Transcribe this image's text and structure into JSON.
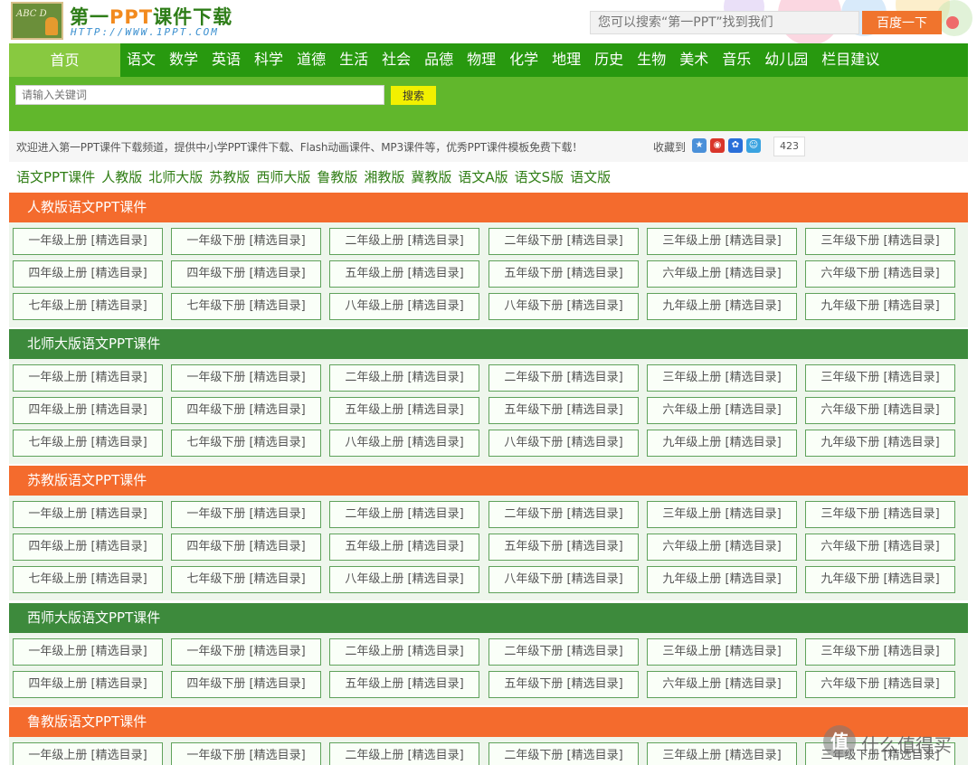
{
  "site": {
    "title_part1": "第一",
    "title_ppt": "PPT",
    "title_part2": "课件下载",
    "url": "HTTP://WWW.1PPT.COM",
    "logo_chalk": "ABC D"
  },
  "top_search": {
    "placeholder": "您可以搜索“第一PPT”找到我们",
    "button": "百度一下"
  },
  "nav": {
    "home": "首页",
    "items": [
      "语文",
      "数学",
      "英语",
      "科学",
      "道德",
      "生活",
      "社会",
      "品德",
      "物理",
      "化学",
      "地理",
      "历史",
      "生物",
      "美术",
      "音乐",
      "幼儿园",
      "栏目建议"
    ]
  },
  "keyword_search": {
    "placeholder": "请输入关键词",
    "button": "搜索"
  },
  "welcome": {
    "message": "欢迎进入第一PPT课件下载频道，提供中小学PPT课件下载、Flash动画课件、MP3课件等，优秀PPT课件模板免费下载！",
    "favorite_label": "收藏到",
    "count": "423"
  },
  "subnav": [
    "语文PPT课件",
    "人教版",
    "北师大版",
    "苏教版",
    "西师大版",
    "鲁教版",
    "湘教版",
    "冀教版",
    "语文A版",
    "语文S版",
    "语文版"
  ],
  "colors": {
    "nav_green": "#28990f",
    "nav_home": "#88c940",
    "band_green": "#61b72c",
    "section_orange": "#f46b2d",
    "section_green": "#3d8a3c",
    "link_green": "#2f7d14"
  },
  "sections": [
    {
      "title": "人教版语文PPT课件",
      "color": "orange",
      "rows": [
        [
          "一年级上册 [精选目录]",
          "一年级下册 [精选目录]",
          "二年级上册 [精选目录]",
          "二年级下册 [精选目录]",
          "三年级上册 [精选目录]",
          "三年级下册 [精选目录]"
        ],
        [
          "四年级上册 [精选目录]",
          "四年级下册 [精选目录]",
          "五年级上册 [精选目录]",
          "五年级下册 [精选目录]",
          "六年级上册 [精选目录]",
          "六年级下册 [精选目录]"
        ],
        [
          "七年级上册 [精选目录]",
          "七年级下册 [精选目录]",
          "八年级上册 [精选目录]",
          "八年级下册 [精选目录]",
          "九年级上册 [精选目录]",
          "九年级下册 [精选目录]"
        ]
      ]
    },
    {
      "title": "北师大版语文PPT课件",
      "color": "green",
      "rows": [
        [
          "一年级上册 [精选目录]",
          "一年级下册 [精选目录]",
          "二年级上册 [精选目录]",
          "二年级下册 [精选目录]",
          "三年级上册 [精选目录]",
          "三年级下册 [精选目录]"
        ],
        [
          "四年级上册 [精选目录]",
          "四年级下册 [精选目录]",
          "五年级上册 [精选目录]",
          "五年级下册 [精选目录]",
          "六年级上册 [精选目录]",
          "六年级下册 [精选目录]"
        ],
        [
          "七年级上册 [精选目录]",
          "七年级下册 [精选目录]",
          "八年级上册 [精选目录]",
          "八年级下册 [精选目录]",
          "九年级上册 [精选目录]",
          "九年级下册 [精选目录]"
        ]
      ]
    },
    {
      "title": "苏教版语文PPT课件",
      "color": "orange",
      "rows": [
        [
          "一年级上册 [精选目录]",
          "一年级下册 [精选目录]",
          "二年级上册 [精选目录]",
          "二年级下册 [精选目录]",
          "三年级上册 [精选目录]",
          "三年级下册 [精选目录]"
        ],
        [
          "四年级上册 [精选目录]",
          "四年级下册 [精选目录]",
          "五年级上册 [精选目录]",
          "五年级下册 [精选目录]",
          "六年级上册 [精选目录]",
          "六年级下册 [精选目录]"
        ],
        [
          "七年级上册 [精选目录]",
          "七年级下册 [精选目录]",
          "八年级上册 [精选目录]",
          "八年级下册 [精选目录]",
          "九年级上册 [精选目录]",
          "九年级下册 [精选目录]"
        ]
      ]
    },
    {
      "title": "西师大版语文PPT课件",
      "color": "green",
      "rows": [
        [
          "一年级上册 [精选目录]",
          "一年级下册 [精选目录]",
          "二年级上册 [精选目录]",
          "二年级下册 [精选目录]",
          "三年级上册 [精选目录]",
          "三年级下册 [精选目录]"
        ],
        [
          "四年级上册 [精选目录]",
          "四年级下册 [精选目录]",
          "五年级上册 [精选目录]",
          "五年级下册 [精选目录]",
          "六年级上册 [精选目录]",
          "六年级下册 [精选目录]"
        ]
      ]
    },
    {
      "title": "鲁教版语文PPT课件",
      "color": "orange",
      "rows": [
        [
          "一年级上册 [精选目录]",
          "一年级下册 [精选目录]",
          "二年级上册 [精选目录]",
          "二年级下册 [精选目录]",
          "三年级上册 [精选目录]",
          "三年级下册 [精选目录]"
        ]
      ]
    }
  ],
  "watermark": {
    "symbol": "值",
    "text": "什么值得买"
  }
}
